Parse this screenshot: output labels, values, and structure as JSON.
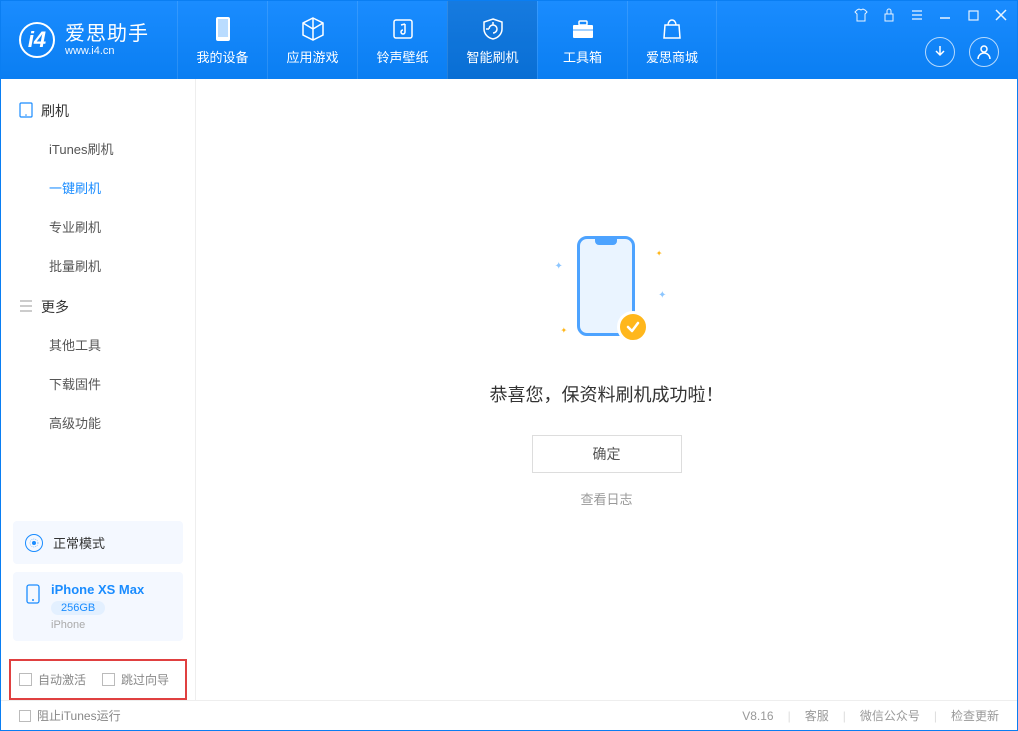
{
  "app": {
    "title": "爱思助手",
    "url": "www.i4.cn"
  },
  "nav": {
    "tabs": [
      {
        "label": "我的设备"
      },
      {
        "label": "应用游戏"
      },
      {
        "label": "铃声壁纸"
      },
      {
        "label": "智能刷机"
      },
      {
        "label": "工具箱"
      },
      {
        "label": "爱思商城"
      }
    ]
  },
  "sidebar": {
    "section1": {
      "title": "刷机"
    },
    "items1": [
      {
        "label": "iTunes刷机"
      },
      {
        "label": "一键刷机"
      },
      {
        "label": "专业刷机"
      },
      {
        "label": "批量刷机"
      }
    ],
    "section2": {
      "title": "更多"
    },
    "items2": [
      {
        "label": "其他工具"
      },
      {
        "label": "下载固件"
      },
      {
        "label": "高级功能"
      }
    ],
    "mode": "正常模式",
    "device": {
      "name": "iPhone XS Max",
      "capacity": "256GB",
      "type": "iPhone"
    },
    "checkboxes": {
      "auto_activate": "自动激活",
      "skip_guide": "跳过向导"
    }
  },
  "main": {
    "success_text": "恭喜您，保资料刷机成功啦！",
    "confirm_label": "确定",
    "log_link": "查看日志"
  },
  "footer": {
    "block_itunes": "阻止iTunes运行",
    "version": "V8.16",
    "links": {
      "service": "客服",
      "wechat": "微信公众号",
      "update": "检查更新"
    }
  }
}
